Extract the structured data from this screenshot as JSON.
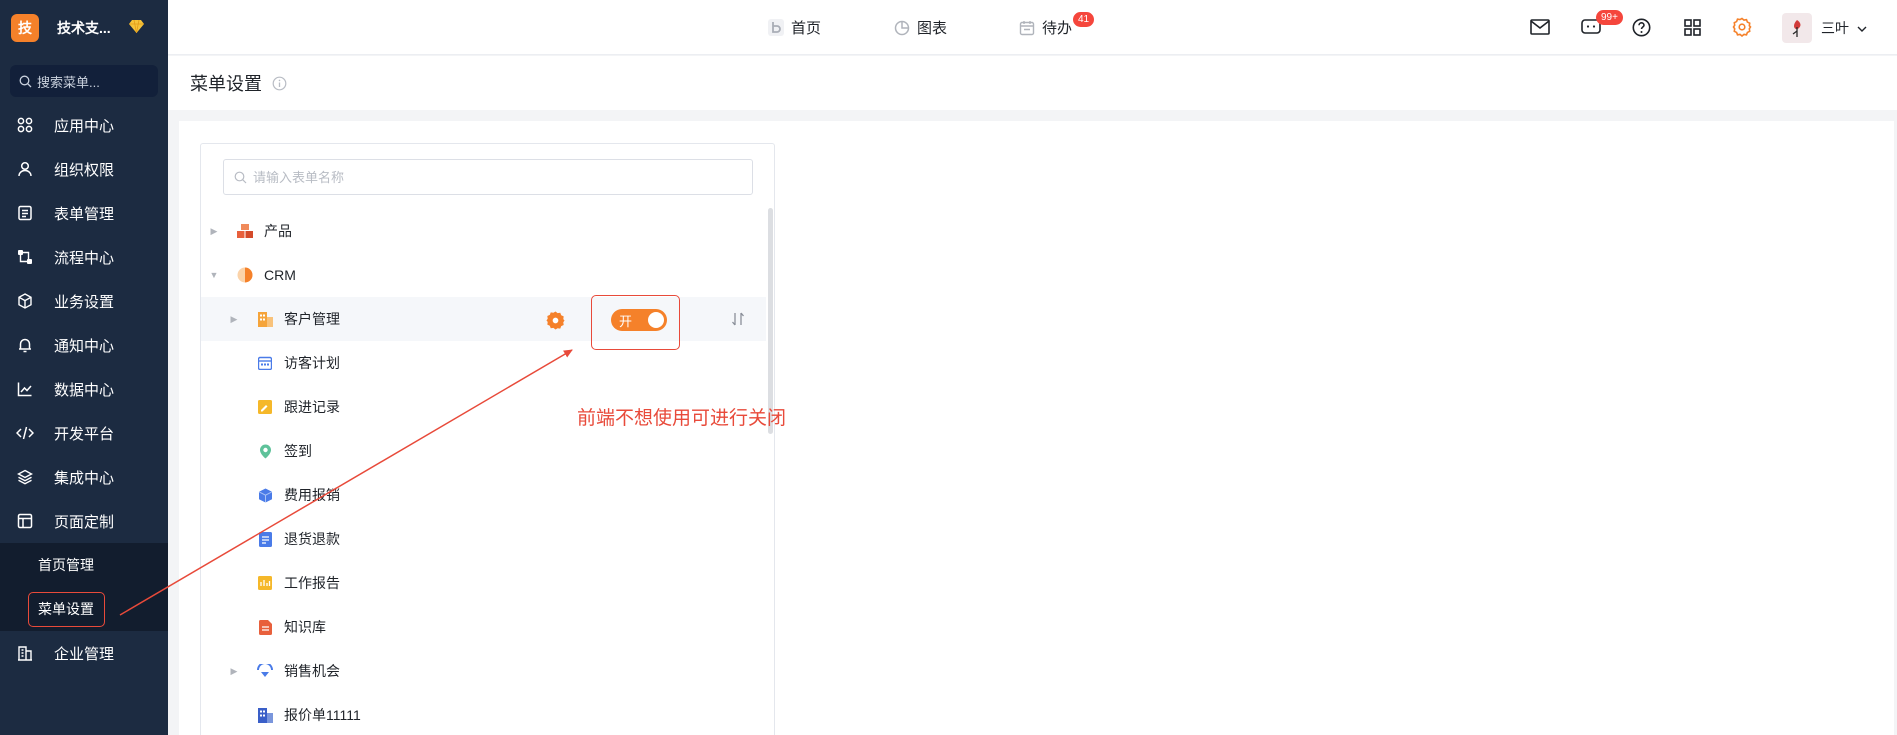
{
  "app": {
    "brand_initial": "技",
    "brand_name": "技术支...",
    "search_placeholder": "搜索菜单..."
  },
  "sidebar": {
    "items": [
      {
        "label": "应用中心",
        "icon": "apps-icon"
      },
      {
        "label": "组织权限",
        "icon": "user-icon"
      },
      {
        "label": "表单管理",
        "icon": "form-icon"
      },
      {
        "label": "流程中心",
        "icon": "flow-icon"
      },
      {
        "label": "业务设置",
        "icon": "cube-icon"
      },
      {
        "label": "通知中心",
        "icon": "bell-icon"
      },
      {
        "label": "数据中心",
        "icon": "chart-line-icon"
      },
      {
        "label": "开发平台",
        "icon": "code-icon"
      },
      {
        "label": "集成中心",
        "icon": "layers-icon"
      },
      {
        "label": "页面定制",
        "icon": "layout-icon"
      }
    ],
    "sub_items": [
      "首页管理",
      "菜单设置"
    ],
    "last_item": {
      "label": "企业管理",
      "icon": "building-icon"
    }
  },
  "topbar": {
    "tabs": [
      {
        "label": "首页",
        "icon": "home-b-icon"
      },
      {
        "label": "图表",
        "icon": "pie-chart-icon"
      },
      {
        "label": "待办",
        "icon": "calendar-icon",
        "badge": "41"
      }
    ],
    "message_badge": "99+",
    "user_name": "三叶"
  },
  "page": {
    "title": "菜单设置"
  },
  "tree": {
    "search_placeholder": "请输入表单名称",
    "rows": [
      {
        "label": "产品",
        "level": 0,
        "caret": "right",
        "icon_color": "#e8603c"
      },
      {
        "label": "CRM",
        "level": 0,
        "caret": "down",
        "icon_color": "#f5812a"
      },
      {
        "label": "客户管理",
        "level": 1,
        "caret": "right",
        "icon_color": "#f5a43a",
        "toggle_label": "开"
      },
      {
        "label": "访客计划",
        "level": 1,
        "caret": "",
        "icon_color": "#4a7be8"
      },
      {
        "label": "跟进记录",
        "level": 1,
        "caret": "",
        "icon_color": "#f5b82a"
      },
      {
        "label": "签到",
        "level": 1,
        "caret": "",
        "icon_color": "#2eb07a"
      },
      {
        "label": "费用报销",
        "level": 1,
        "caret": "",
        "icon_color": "#4a7be8"
      },
      {
        "label": "退货退款",
        "level": 1,
        "caret": "",
        "icon_color": "#4a7be8"
      },
      {
        "label": "工作报告",
        "level": 1,
        "caret": "",
        "icon_color": "#f5b82a"
      },
      {
        "label": "知识库",
        "level": 1,
        "caret": "",
        "icon_color": "#e8603c"
      },
      {
        "label": "销售机会",
        "level": 1,
        "caret": "right",
        "icon_color": "#4a7be8"
      },
      {
        "label": "报价单11111",
        "level": 1,
        "caret": "",
        "icon_color": "#3a5fc8"
      }
    ]
  },
  "annotation": {
    "text": "前端不想使用可进行关闭",
    "color": "#e84a3a"
  },
  "colors": {
    "sidebar_bg": "#1c2b41",
    "accent": "#f5812a",
    "annotation": "#e84a3a"
  }
}
